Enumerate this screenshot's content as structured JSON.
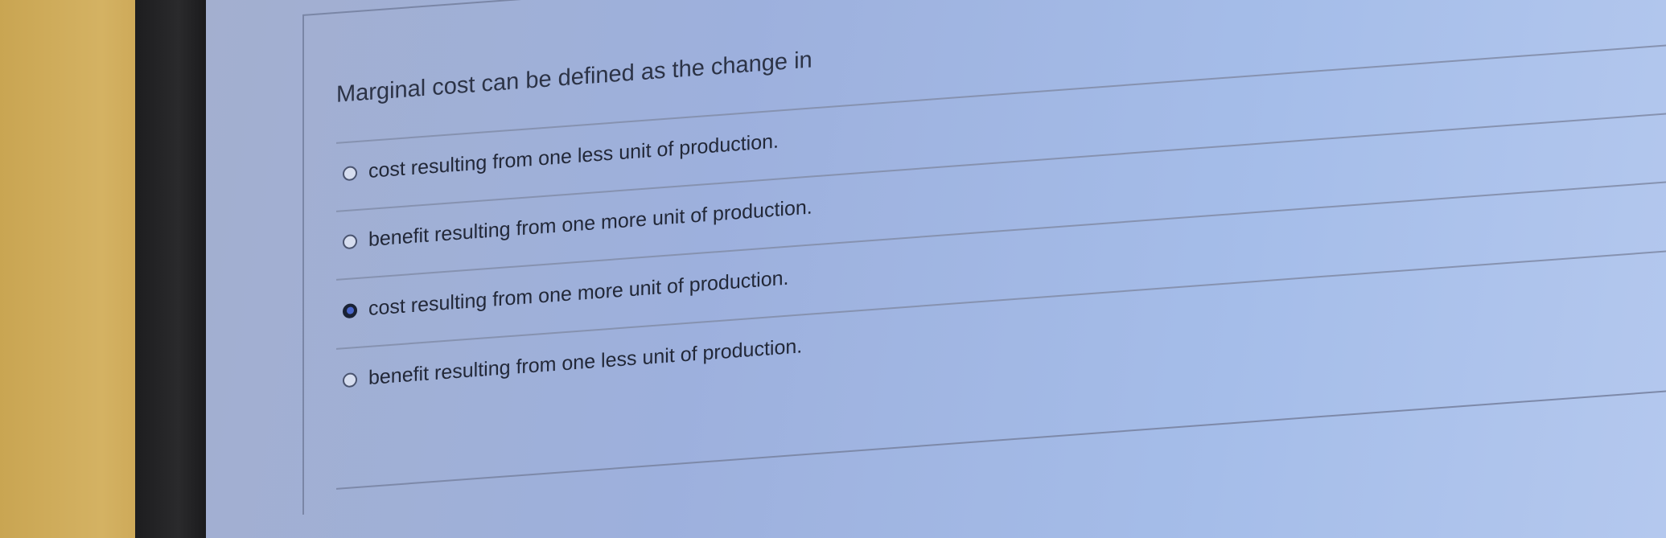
{
  "question": {
    "text": "Marginal cost can be defined as the change in"
  },
  "options": [
    {
      "label": "cost resulting from one less unit of production.",
      "selected": false
    },
    {
      "label": "benefit resulting from one more unit of production.",
      "selected": false
    },
    {
      "label": "cost resulting from one more unit of production.",
      "selected": true
    },
    {
      "label": "benefit resulting from one less unit of production.",
      "selected": false
    }
  ],
  "colors": {
    "screen_background": "#a5bde9",
    "text": "#222838",
    "selected_radio": "#1a2234",
    "bezel": "#1d1d1f"
  }
}
